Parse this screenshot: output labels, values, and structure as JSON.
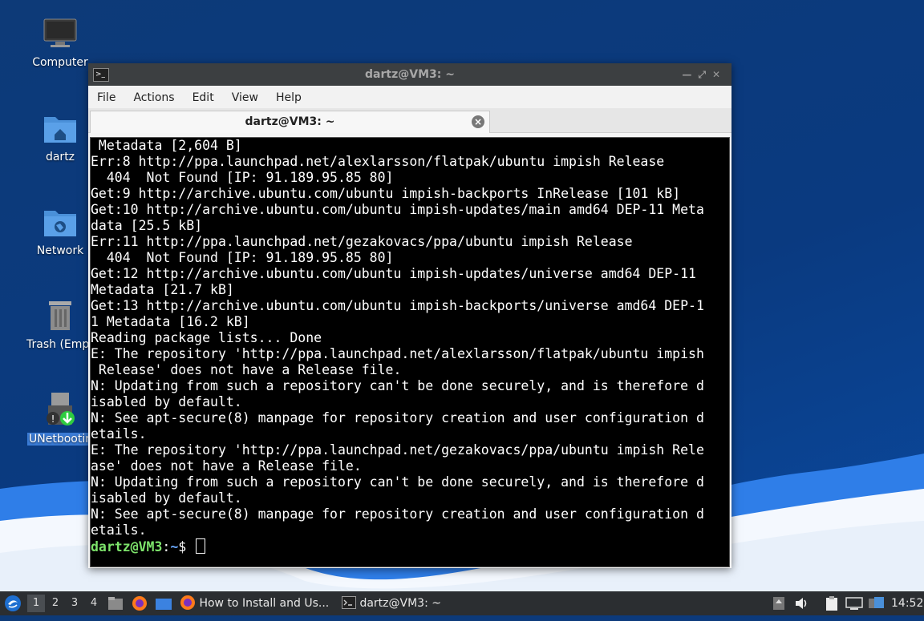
{
  "desktop": {
    "icons": [
      {
        "label": "Computer"
      },
      {
        "label": "dartz"
      },
      {
        "label": "Network"
      },
      {
        "label": "Trash (Empty)"
      },
      {
        "label": "UNetbootin"
      }
    ]
  },
  "window": {
    "title": "dartz@VM3: ~",
    "menu": [
      "File",
      "Actions",
      "Edit",
      "View",
      "Help"
    ],
    "tab_label": "dartz@VM3: ~"
  },
  "terminal": {
    "lines": [
      " Metadata [2,604 B]",
      "Err:8 http://ppa.launchpad.net/alexlarsson/flatpak/ubuntu impish Release",
      "  404  Not Found [IP: 91.189.95.85 80]",
      "Get:9 http://archive.ubuntu.com/ubuntu impish-backports InRelease [101 kB]",
      "Get:10 http://archive.ubuntu.com/ubuntu impish-updates/main amd64 DEP-11 Meta",
      "data [25.5 kB]",
      "Err:11 http://ppa.launchpad.net/gezakovacs/ppa/ubuntu impish Release",
      "  404  Not Found [IP: 91.189.95.85 80]",
      "Get:12 http://archive.ubuntu.com/ubuntu impish-updates/universe amd64 DEP-11",
      "Metadata [21.7 kB]",
      "Get:13 http://archive.ubuntu.com/ubuntu impish-backports/universe amd64 DEP-1",
      "1 Metadata [16.2 kB]",
      "Reading package lists... Done",
      "E: The repository 'http://ppa.launchpad.net/alexlarsson/flatpak/ubuntu impish",
      " Release' does not have a Release file.",
      "N: Updating from such a repository can't be done securely, and is therefore d",
      "isabled by default.",
      "N: See apt-secure(8) manpage for repository creation and user configuration d",
      "etails.",
      "E: The repository 'http://ppa.launchpad.net/gezakovacs/ppa/ubuntu impish Rele",
      "ase' does not have a Release file.",
      "N: Updating from such a repository can't be done securely, and is therefore d",
      "isabled by default.",
      "N: See apt-secure(8) manpage for repository creation and user configuration d",
      "etails."
    ],
    "prompt_user": "dartz@VM3",
    "prompt_sep": ":",
    "prompt_path": "~",
    "prompt_symbol": "$ "
  },
  "taskbar": {
    "workspaces": [
      "1",
      "2",
      "3",
      "4"
    ],
    "tasks": [
      {
        "label": "How to Install and Us..."
      },
      {
        "label": "dartz@VM3: ~"
      }
    ],
    "clock": "14:52"
  },
  "colors": {
    "prompt_user": "#7de36b",
    "prompt_path": "#6aa9ff",
    "terminal_bg": "#000000",
    "taskbar_bg": "#2b2e31"
  }
}
